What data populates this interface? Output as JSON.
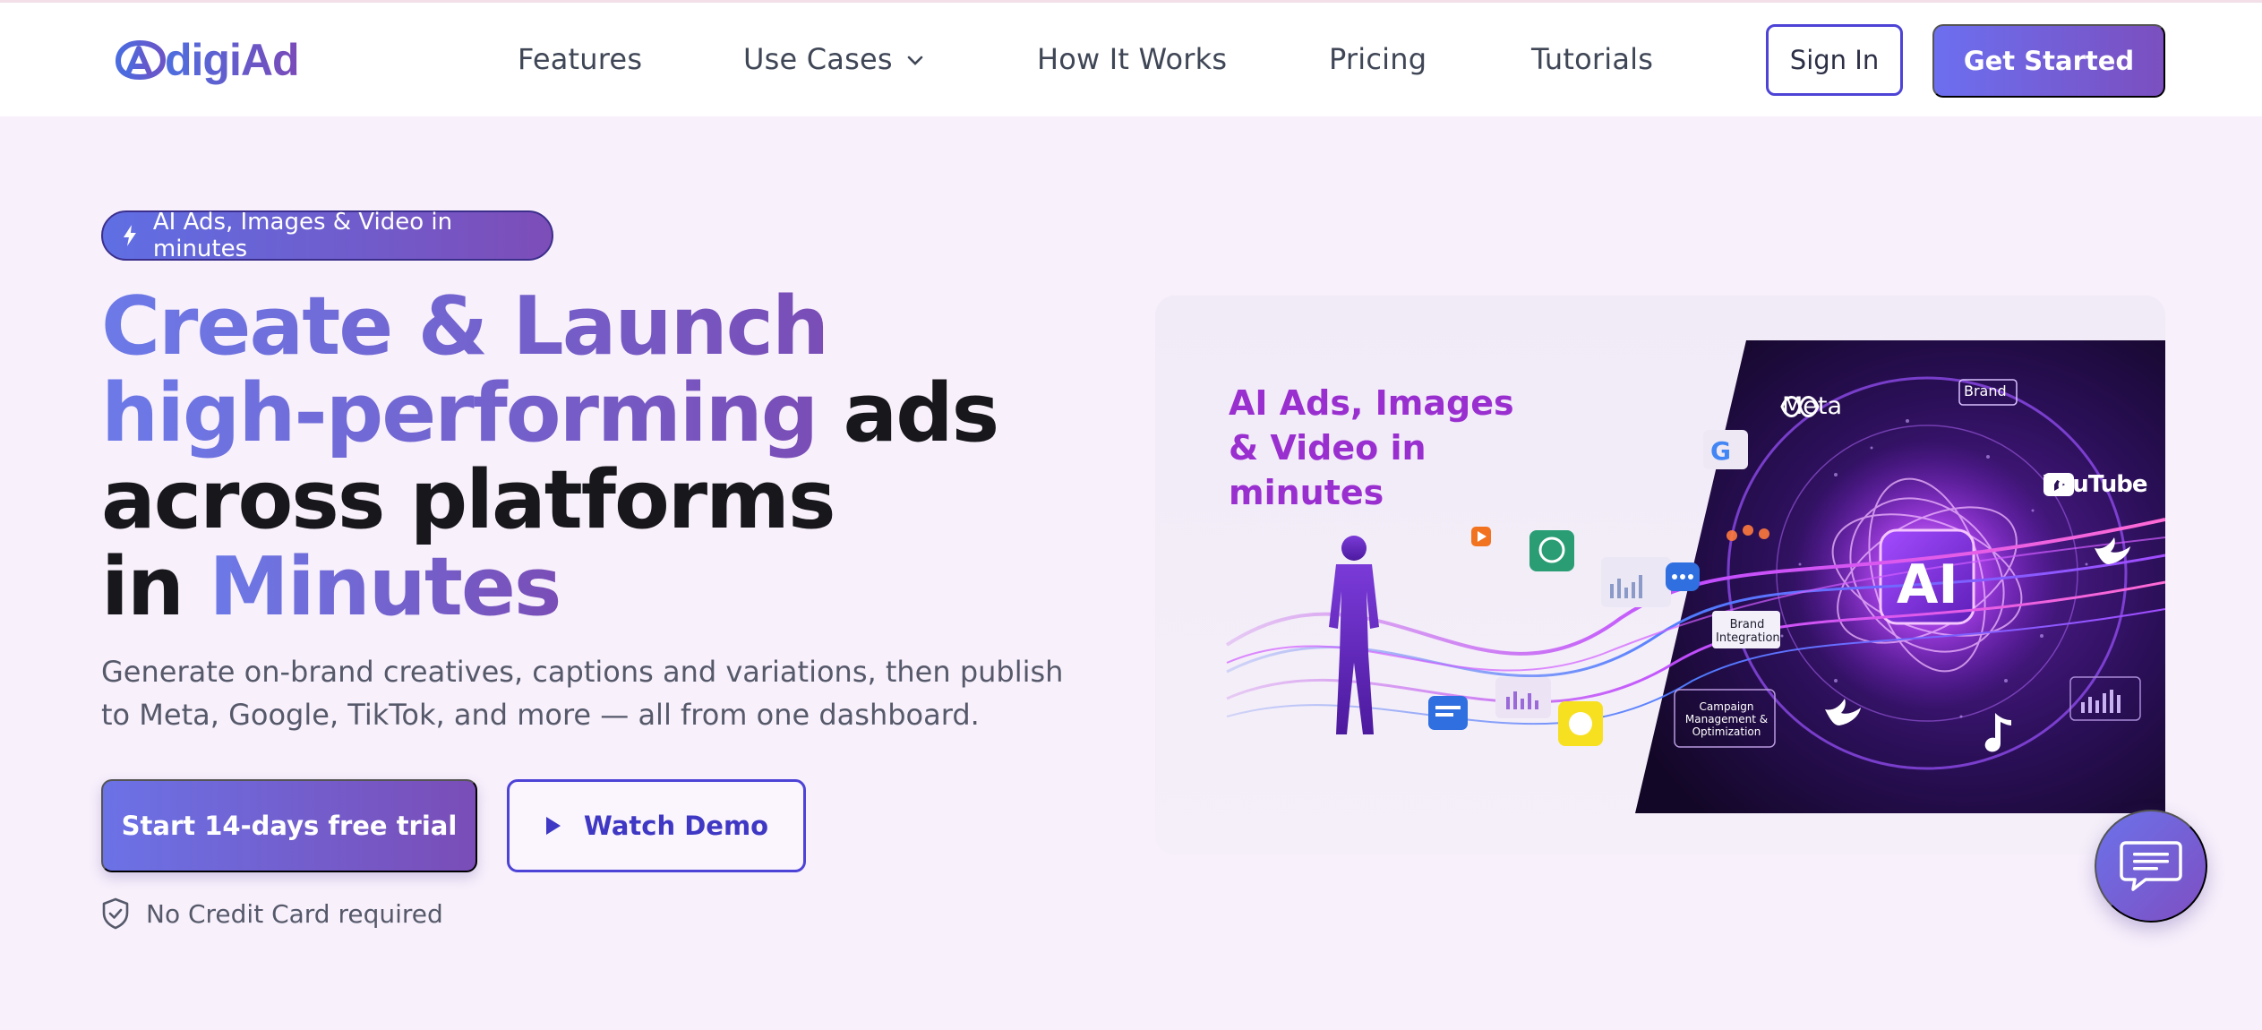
{
  "brand": {
    "name": "digiAd"
  },
  "nav": {
    "items": [
      {
        "label": "Features"
      },
      {
        "label": "Use Cases"
      },
      {
        "label": "How It Works"
      },
      {
        "label": "Pricing"
      },
      {
        "label": "Tutorials"
      }
    ],
    "signin_label": "Sign In",
    "getstarted_label": "Get Started"
  },
  "hero": {
    "badge": "AI Ads, Images & Video in minutes",
    "headline": {
      "line1": "Create & Launch",
      "line2_grad": "high-performing",
      "line2_dark": " ads",
      "line3": "across platforms",
      "line4_dark": "in ",
      "line4_grad": "Minutes"
    },
    "subtext": "Generate on-brand creatives, captions and variations, then publish to Meta, Google, TikTok, and more — all from one dashboard.",
    "trial_label": "Start 14-days free trial",
    "demo_label": "Watch Demo",
    "no_cc": "No Credit Card required"
  },
  "hero_image": {
    "title": "AI Ads, Images & Video in minutes",
    "meta": "Meta",
    "brand": "Brand",
    "youtube": "YouTube",
    "ai": "AI",
    "brand_integration": "Brand Integration",
    "campaign": "Campaign Management & Optimization"
  },
  "colors": {
    "accent_start": "#6c72ea",
    "accent_end": "#7a4db7",
    "border_accent": "#4d43d6",
    "page_bg": "#f8f0fb"
  }
}
